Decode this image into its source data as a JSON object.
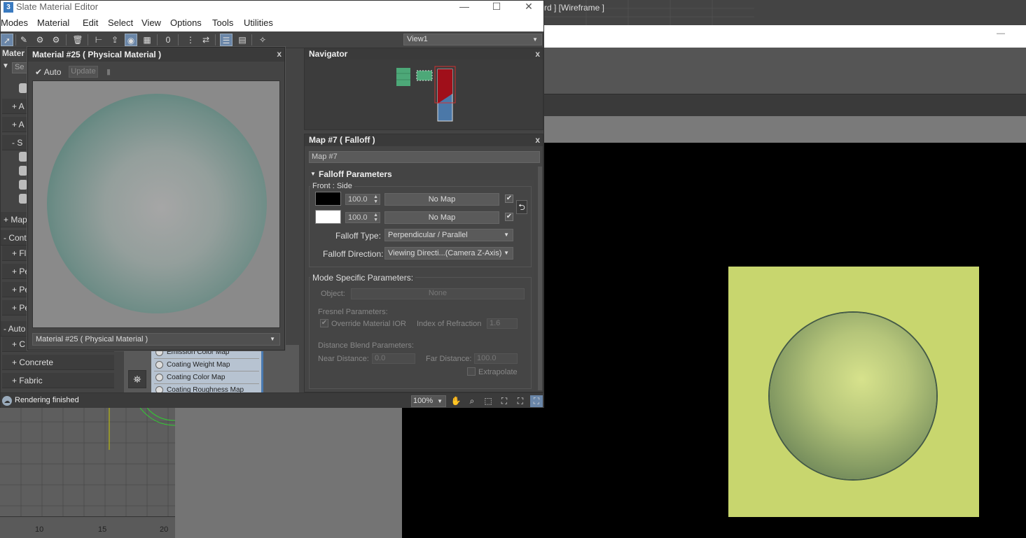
{
  "app": {
    "title": "Slate Material Editor",
    "icon_label": "3",
    "win_minimize": "—",
    "win_maximize": "☐",
    "win_close": "✕"
  },
  "menubar": [
    "Modes",
    "Material",
    "Edit",
    "Select",
    "View",
    "Options",
    "Tools",
    "Utilities"
  ],
  "toolbar": {
    "view_select": "View1"
  },
  "browser": {
    "header": "Mater",
    "rows": [
      {
        "label": "+ A"
      },
      {
        "label": "+ A"
      },
      {
        "label": "- S"
      },
      {
        "label": "+ Map"
      },
      {
        "label": "- Cont"
      },
      {
        "label": "+ Fl"
      },
      {
        "label": "+ Pe"
      },
      {
        "label": "+ Pe"
      },
      {
        "label": "+ Pe"
      },
      {
        "label": "- Auto"
      },
      {
        "label": "+ C"
      },
      {
        "label": "+ Concrete"
      },
      {
        "label": "+ Fabric"
      }
    ],
    "search_label": "Se"
  },
  "preview": {
    "title": "Material #25  ( Physical Material )",
    "close": "x",
    "auto_label": "Auto",
    "auto_check": "✔",
    "update_label": "Update",
    "select_value": "Material #25  ( Physical Material )"
  },
  "nodes": {
    "slots": [
      "Emission Color Map",
      "Coating Weight Map",
      "Coating Color Map",
      "Coating Roughness Map"
    ]
  },
  "navigator": {
    "title": "Navigator",
    "close": "x"
  },
  "map_panel": {
    "title": "Map #7  ( Falloff )",
    "close": "x",
    "name_field": "Map #7",
    "rollout_title": "Falloff Parameters",
    "front_side_label": "Front : Side",
    "rows": [
      {
        "swatch_color": "#000000",
        "value": "100.0",
        "map": "No Map",
        "checked": "✔"
      },
      {
        "swatch_color": "#ffffff",
        "value": "100.0",
        "map": "No Map",
        "checked": "✔"
      }
    ],
    "swap_icon": "⮌",
    "falloff_type_label": "Falloff Type:",
    "falloff_type_value": "Perpendicular / Parallel",
    "falloff_direction_label": "Falloff Direction:",
    "falloff_direction_value": "Viewing Directi...(Camera Z-Axis)",
    "mode_specific_label": "Mode Specific Parameters:",
    "object_label": "Object:",
    "object_value": "None",
    "fresnel_label": "Fresnel Parameters:",
    "override_ior_label": "Override Material IOR",
    "ior_label": "Index of Refraction",
    "ior_value": "1.6",
    "distance_blend_label": "Distance Blend Parameters:",
    "near_label": "Near Distance:",
    "near_value": "0.0",
    "far_label": "Far Distance:",
    "far_value": "100.0",
    "extrapolate_label": "Extrapolate"
  },
  "statusbar": {
    "text": "Rendering finished",
    "zoom": "100%"
  },
  "background": {
    "viewport_label": "rd ] [Wireframe ]",
    "ruler": [
      "10",
      "15",
      "20"
    ],
    "render_bg_color": "#c8d66e"
  }
}
